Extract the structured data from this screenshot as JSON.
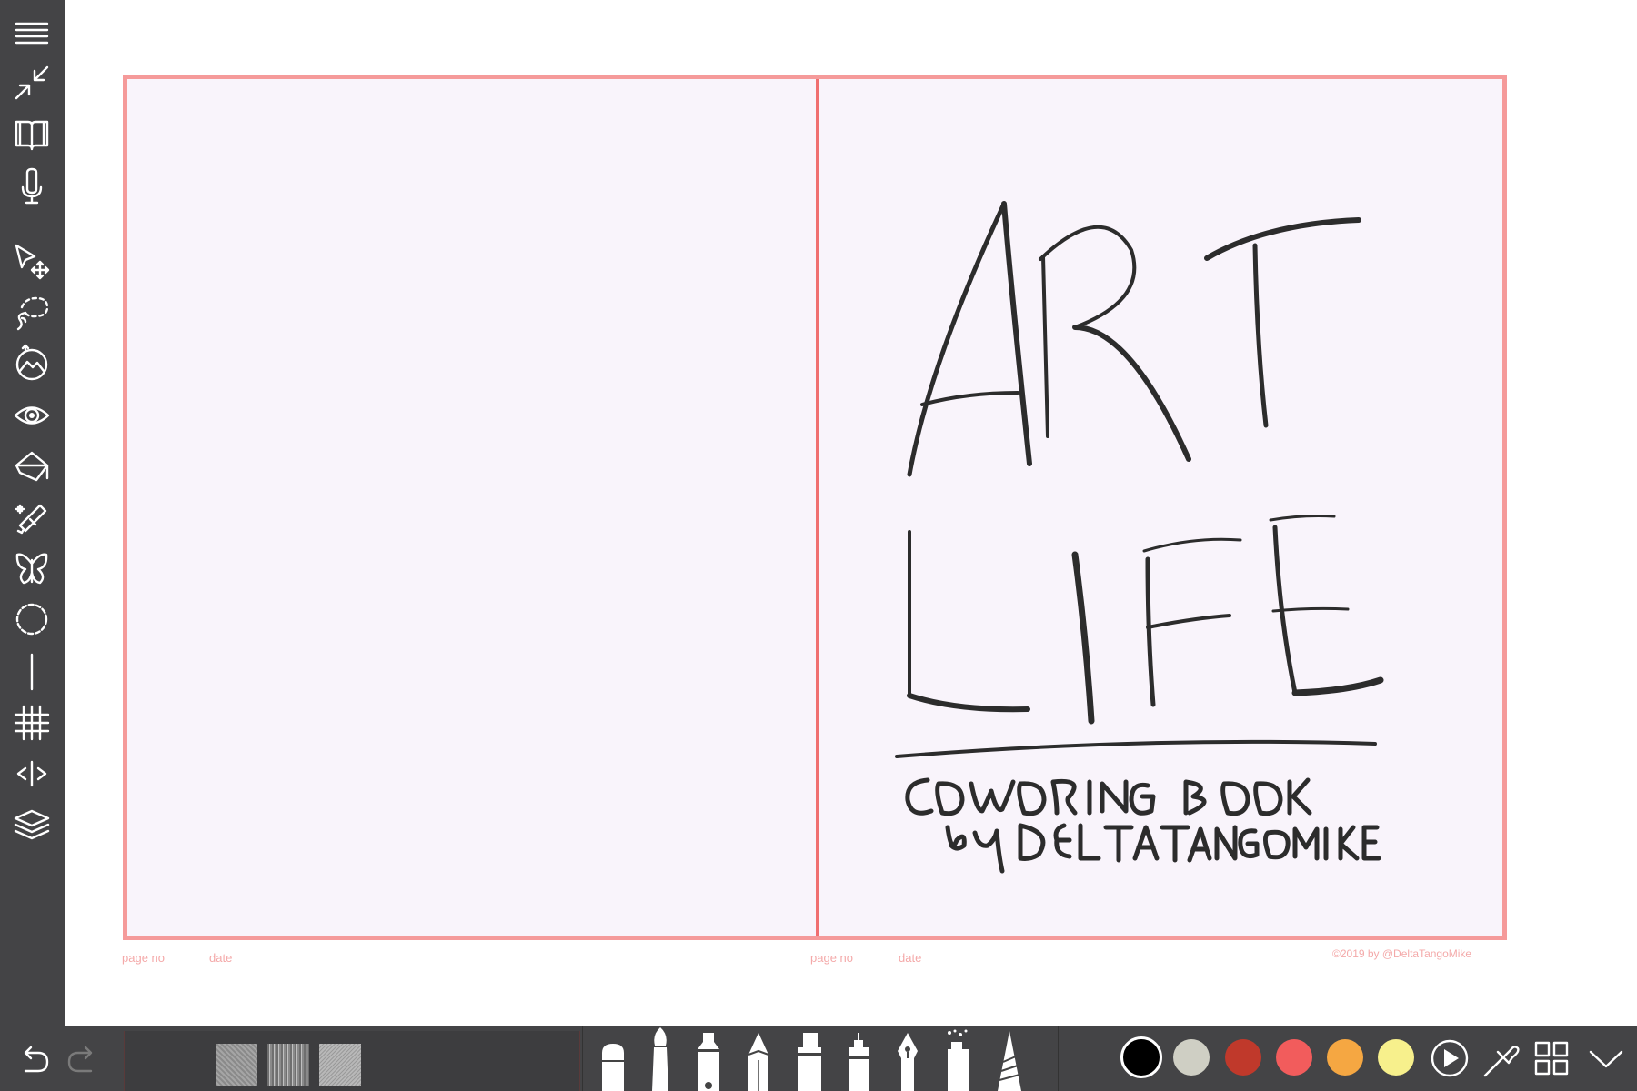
{
  "sidebar": {
    "items": [
      {
        "name": "menu-icon",
        "label": "Menu"
      },
      {
        "name": "collapse-icon",
        "label": "Exit fullscreen"
      },
      {
        "name": "book-icon",
        "label": "Book"
      },
      {
        "name": "microphone-icon",
        "label": "Voice"
      },
      {
        "name": "select-move-icon",
        "label": "Select/Move"
      },
      {
        "name": "lasso-icon",
        "label": "Lasso"
      },
      {
        "name": "image-icon",
        "label": "Image"
      },
      {
        "name": "eye-icon",
        "label": "View"
      },
      {
        "name": "fill-bucket-icon",
        "label": "Fill"
      },
      {
        "name": "magic-eraser-icon",
        "label": "Magic"
      },
      {
        "name": "butterfly-icon",
        "label": "Symmetry"
      },
      {
        "name": "circle-guide-icon",
        "label": "Circle guide"
      },
      {
        "name": "line-guide-icon",
        "label": "Line guide"
      },
      {
        "name": "grid-icon",
        "label": "Grid"
      },
      {
        "name": "mirror-icon",
        "label": "Mirror"
      },
      {
        "name": "layers-icon",
        "label": "Layers"
      }
    ]
  },
  "page": {
    "left_page_no": "page no",
    "left_date": "date",
    "right_page_no": "page no",
    "right_date": "date",
    "copyright": "©2019 by @DeltaTangoMike"
  },
  "drawing": {
    "line1": "ART",
    "line2": "LIFE",
    "line3": "COLORING BOOK",
    "line4": "by DELTATANGOMIKE"
  },
  "bottombar": {
    "undo": "undo-icon",
    "redo": "redo-icon",
    "textures": [
      "texture-paper-1",
      "texture-paper-2",
      "texture-paper-3"
    ],
    "tools": [
      "marker",
      "brush",
      "felt-pen",
      "pencil",
      "highlighter",
      "fineliner",
      "fountain-pen",
      "spray-can",
      "crayon"
    ],
    "colors": [
      "#000000",
      "#cfcfc4",
      "#c0392b",
      "#f25c5c",
      "#f5a742",
      "#f7f08c"
    ],
    "selected_color": "#000000",
    "icons": [
      "play-icon",
      "eyedropper-icon",
      "grid-view-icon",
      "chevron-down-icon"
    ]
  },
  "colors": {
    "sidebar_bg": "#444446",
    "page_border": "#f59a9a",
    "page_bg": "#f9f4fb",
    "spine": "#f06f70",
    "footer_text": "#f4a9a9"
  }
}
